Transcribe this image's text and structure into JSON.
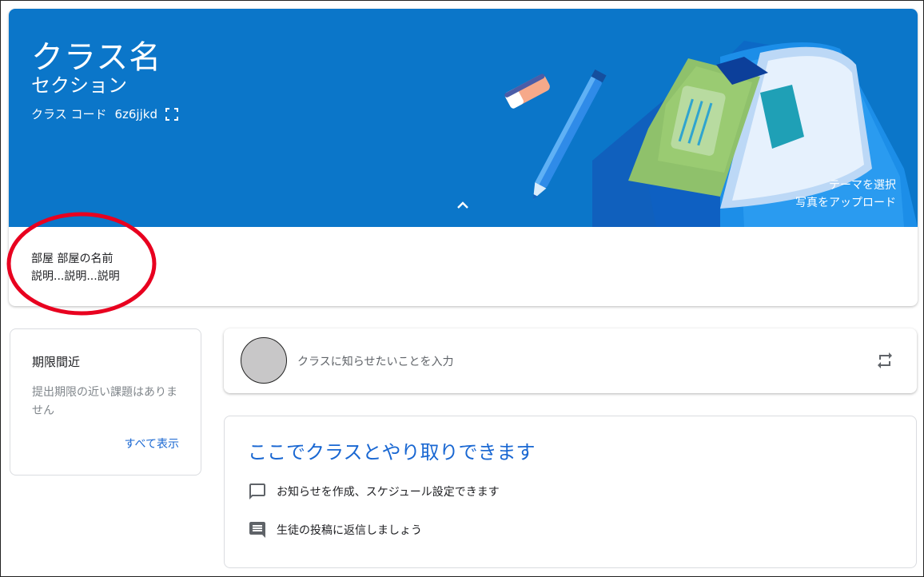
{
  "banner": {
    "class_name": "クラス名",
    "section": "セクション",
    "class_code_label": "クラス コード",
    "class_code_value": "6z6jjkd",
    "select_theme": "テーマを選択",
    "upload_photo": "写真をアップロード",
    "background_color": "#0b76c9"
  },
  "room": {
    "line1": "部屋 部屋の名前",
    "line2": "説明...説明...説明",
    "annotation_color": "#e8001f"
  },
  "upcoming": {
    "title": "期限間近",
    "empty_text": "提出期限の近い課題はありません",
    "view_all": "すべて表示"
  },
  "stream": {
    "post_placeholder": "クラスに知らせたいことを入力"
  },
  "info": {
    "title": "ここでクラスとやり取りできます",
    "items": [
      {
        "icon": "chat-bubble-icon",
        "text": "お知らせを作成、スケジュール設定できます"
      },
      {
        "icon": "comment-icon",
        "text": "生徒の投稿に返信しましょう"
      }
    ]
  },
  "colors": {
    "accent": "#1967d2",
    "banner": "#0b76c9",
    "avatar": "#c8c7c8"
  }
}
